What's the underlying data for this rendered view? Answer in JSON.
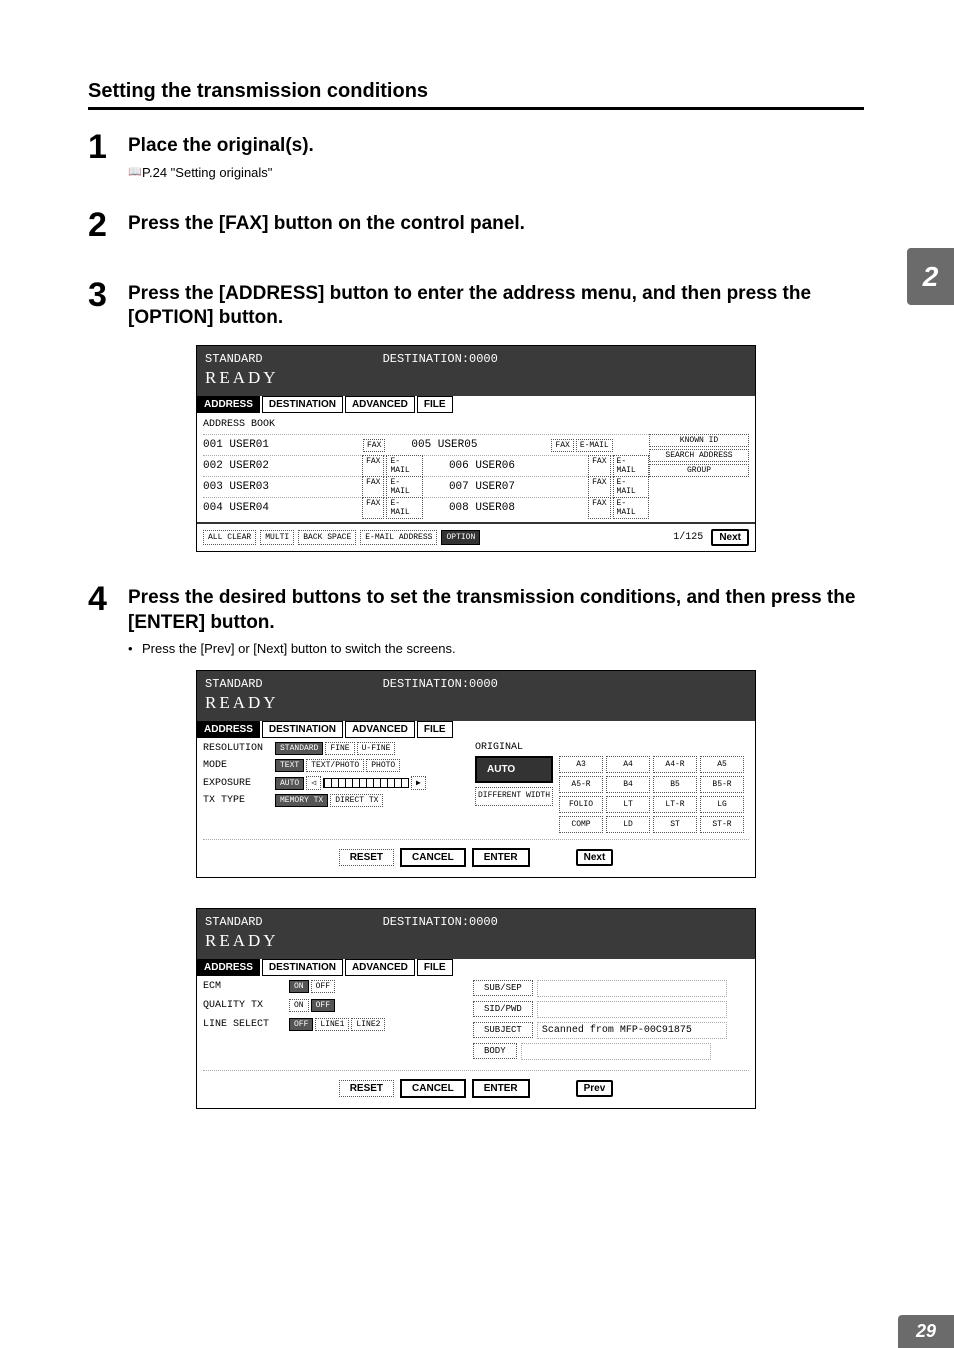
{
  "chapter_tab": "2",
  "page_number": "29",
  "section_title": "Setting the transmission conditions",
  "steps": [
    {
      "num": "1",
      "title": "Place the original(s).",
      "bullet": "P.24 \"Setting originals\""
    },
    {
      "num": "2",
      "title": "Press the [FAX] button on the control panel."
    },
    {
      "num": "3",
      "title": "Press the [ADDRESS] button to enter the address menu, and then press the [OPTION] button."
    },
    {
      "num": "4",
      "title": "Press the desired buttons to set the transmission conditions, and then press the [ENTER] button.",
      "bullet": "Press the [Prev] or [Next] button to switch the screens."
    }
  ],
  "panel_shared": {
    "status": "STANDARD",
    "destination_label": "DESTINATION:0000",
    "ready": "READY",
    "tabs": {
      "address": "ADDRESS",
      "destination": "DESTINATION",
      "advanced": "ADVANCED",
      "file": "FILE"
    }
  },
  "panel1": {
    "address_book_label": "ADDRESS BOOK",
    "rows": [
      {
        "name": "001 USER01",
        "tags": [
          "FAX"
        ],
        "name2": "005 USER05",
        "tags2": [
          "FAX",
          "E-MAIL"
        ]
      },
      {
        "name": "002 USER02",
        "tags": [
          "FAX",
          "E-MAIL"
        ],
        "name2": "006 USER06",
        "tags2": [
          "FAX",
          "E-MAIL"
        ]
      },
      {
        "name": "003 USER03",
        "tags": [
          "FAX",
          "E-MAIL"
        ],
        "name2": "007 USER07",
        "tags2": [
          "FAX",
          "E-MAIL"
        ]
      },
      {
        "name": "004 USER04",
        "tags": [
          "FAX",
          "E-MAIL"
        ],
        "name2": "008 USER08",
        "tags2": [
          "FAX",
          "E-MAIL"
        ]
      }
    ],
    "side": [
      "KNOWN ID",
      "SEARCH ADDRESS",
      "GROUP"
    ],
    "footer": {
      "all_clear": "ALL CLEAR",
      "multi": "MULTI",
      "back_space": "BACK SPACE",
      "email_address": "E-MAIL ADDRESS",
      "option": "OPTION",
      "page": "1/125",
      "next": "Next"
    }
  },
  "panel2": {
    "labels": {
      "resolution": "RESOLUTION",
      "mode": "MODE",
      "exposure": "EXPOSURE",
      "txtype": "TX TYPE",
      "original": "ORIGINAL"
    },
    "resolution_opts": [
      "STANDARD",
      "FINE",
      "U-FINE"
    ],
    "mode_opts": [
      "TEXT",
      "TEXT/PHOTO",
      "PHOTO"
    ],
    "exposure_auto": "AUTO",
    "txtype_opts": [
      "MEMORY TX",
      "DIRECT TX"
    ],
    "auto": "AUTO",
    "different_width": "DIFFERENT\nWIDTH",
    "sizes": [
      "A3",
      "A4",
      "A4-R",
      "A5",
      "A5-R",
      "B4",
      "B5",
      "B5-R",
      "FOLIO",
      "LT",
      "LT-R",
      "LG",
      "COMP",
      "LD",
      "ST",
      "ST-R"
    ],
    "reset": "RESET",
    "cancel": "CANCEL",
    "enter": "ENTER",
    "next": "Next"
  },
  "panel3": {
    "labels": {
      "ecm": "ECM",
      "qualitytx": "QUALITY TX",
      "lineselect": "LINE SELECT"
    },
    "on": "ON",
    "off": "OFF",
    "line_opts": [
      "OFF",
      "LINE1",
      "LINE2"
    ],
    "right_buttons": {
      "subsep": "SUB/SEP",
      "sidpwd": "SID/PWD",
      "subject": "SUBJECT",
      "body": "BODY"
    },
    "subject_value": "Scanned from MFP-00C91875",
    "reset": "RESET",
    "cancel": "CANCEL",
    "enter": "ENTER",
    "prev": "Prev"
  }
}
